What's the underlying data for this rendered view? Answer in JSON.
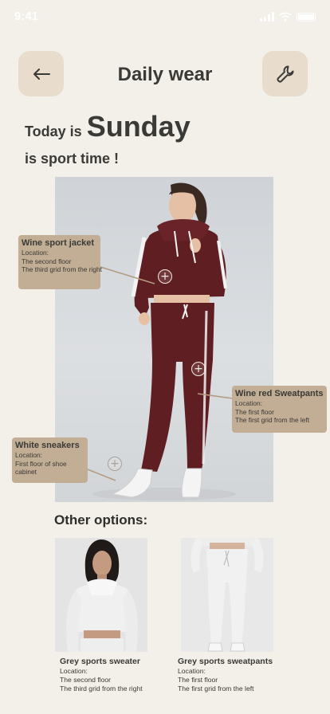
{
  "status_bar": {
    "time": "9:41"
  },
  "header": {
    "title": "Daily wear",
    "back_icon": "arrow-left-icon",
    "tool_icon": "wrench-icon"
  },
  "intro": {
    "today_prefix": "Today is",
    "day": "Sunday",
    "subtitle": "is sport time !"
  },
  "outfit_items": [
    {
      "name": "Wine sport jacket",
      "lines": [
        "Location:",
        "The second floor",
        "The third grid from the right"
      ]
    },
    {
      "name": "Wine red Sweatpants",
      "lines": [
        "Location:",
        "The first floor",
        "The first grid from the left"
      ]
    },
    {
      "name": "White sneakers",
      "lines": [
        "Location:",
        "First floor of shoe",
        "cabinet"
      ]
    }
  ],
  "other_options": {
    "title": "Other options:",
    "items": [
      {
        "name": "Grey sports sweater",
        "lines": [
          "Location:",
          "The second floor",
          "The third grid from the right"
        ]
      },
      {
        "name": "Grey sports sweatpants",
        "lines": [
          "Location:",
          "The first floor",
          "The first grid from the left"
        ]
      }
    ]
  },
  "colors": {
    "background": "#f3efe9",
    "button_bg": "#e8dccd",
    "tag_bg": "#c2ad95",
    "outfit": "#5e1e22"
  }
}
